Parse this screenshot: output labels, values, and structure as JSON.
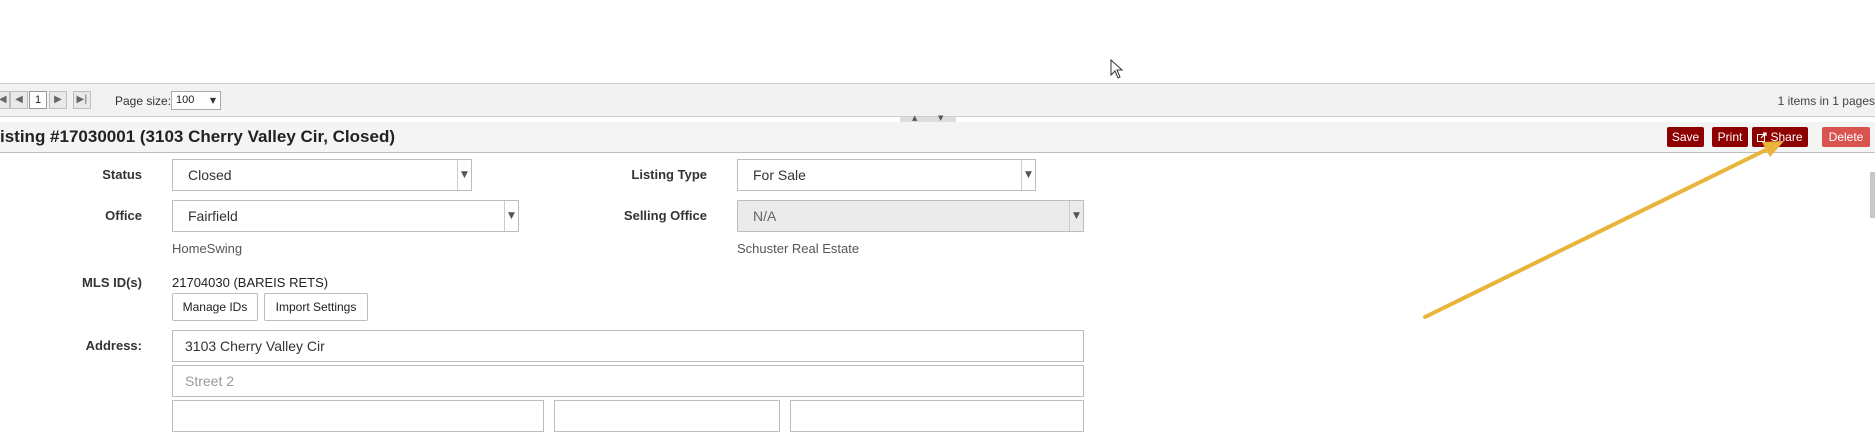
{
  "pager": {
    "current_page": "1",
    "page_size_label": "Page size:",
    "page_size_value": "100",
    "items_info": "1 items in 1 pages"
  },
  "listing": {
    "title": "isting #17030001 (3103 Cherry Valley Cir, Closed)",
    "actions": {
      "save_label": "Save",
      "print_label": "Print",
      "share_label": "Share",
      "delete_label": "Delete"
    }
  },
  "form": {
    "status_label": "Status",
    "status_value": "Closed",
    "listing_type_label": "Listing Type",
    "listing_type_value": "For Sale",
    "office_label": "Office",
    "office_value": "Fairfield",
    "office_hint": "HomeSwing",
    "selling_office_label": "Selling Office",
    "selling_office_value": "N/A",
    "selling_office_hint": "Schuster Real Estate",
    "mls_label": "MLS ID(s)",
    "mls_value": "21704030 (BAREIS RETS)",
    "manage_ids_label": "Manage IDs",
    "import_settings_label": "Import Settings",
    "address_label": "Address:",
    "address_line1": "3103 Cherry Valley Cir",
    "address_line2_placeholder": "Street 2"
  },
  "icons": {
    "first_page": "first-page-icon",
    "prev_page": "prev-page-icon",
    "next_page": "next-page-icon",
    "last_page": "last-page-icon",
    "share": "share-icon",
    "dropdown": "chevron-down-icon",
    "cursor": "mouse-cursor-icon"
  },
  "colors": {
    "action_button": "#8e0000",
    "delete_button": "#d9534f",
    "annotation_arrow": "#e8b53a"
  }
}
